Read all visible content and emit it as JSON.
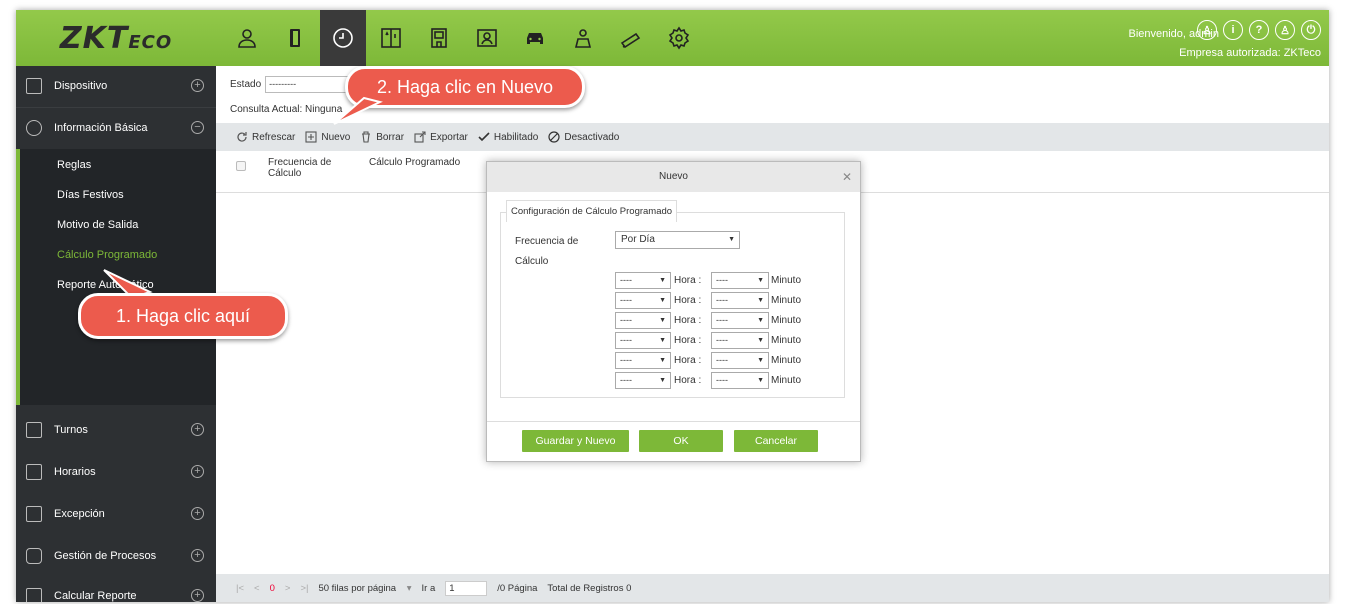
{
  "header": {
    "logo": "ZKTeco",
    "welcome": "Bienvenido, admin",
    "company": "Empresa autorizada: ZKTeco",
    "modules": [
      "person-icon",
      "door-icon",
      "clock-icon",
      "elevator-icon",
      "hotel-icon",
      "visitor-icon",
      "parking-icon",
      "patrol-icon",
      "video-icon",
      "settings-icon"
    ],
    "right_icons": [
      "user-circle-icon",
      "info-icon",
      "help-icon",
      "account-icon",
      "power-icon"
    ]
  },
  "sidebar": {
    "items": [
      {
        "label": "Dispositivo",
        "expand": "+"
      },
      {
        "label": "Información Básica",
        "expand": "−"
      },
      {
        "label": "Turnos",
        "expand": "+"
      },
      {
        "label": "Horarios",
        "expand": "+"
      },
      {
        "label": "Excepción",
        "expand": "+"
      },
      {
        "label": "Gestión de Procesos",
        "expand": "+"
      },
      {
        "label": "Calcular Reporte",
        "expand": "+"
      }
    ],
    "submenu": [
      "Reglas",
      "Días Festivos",
      "Motivo de Salida",
      "Cálculo Programado",
      "Reporte Automático"
    ]
  },
  "filter": {
    "label": "Estado",
    "value": "---------"
  },
  "query": "Consulta Actual: Ninguna",
  "toolbar": {
    "refresh": "Refrescar",
    "new": "Nuevo",
    "delete": "Borrar",
    "export": "Exportar",
    "enabled": "Habilitado",
    "disabled": "Desactivado"
  },
  "table": {
    "columns": [
      "Frecuencia de Cálculo",
      "Cálculo Programado"
    ]
  },
  "footer": {
    "nav": [
      "|<",
      "<",
      "0",
      ">",
      ">|"
    ],
    "rows_per_page": "50 filas por página",
    "goto_label": "Ir a",
    "goto_value": "1",
    "pages": "/0 Página",
    "total": "Total de Registros 0"
  },
  "dialog": {
    "title": "Nuevo",
    "legend": "Configuración de Cálculo Programado",
    "freq_label_1": "Frecuencia de",
    "freq_label_2": "Cálculo",
    "freq_value": "Por Día",
    "hour_placeholder": "----",
    "hour_label": "Hora :",
    "minute_label": "Minuto",
    "rows": 6,
    "btn_save_new": "Guardar y Nuevo",
    "btn_ok": "OK",
    "btn_cancel": "Cancelar"
  },
  "callouts": {
    "step1": "1. Haga clic aquí",
    "step2": "2. Haga clic en Nuevo"
  },
  "colors": {
    "accent": "#7db838",
    "callout": "#ec5b4d",
    "sidebar": "#2d3033"
  }
}
